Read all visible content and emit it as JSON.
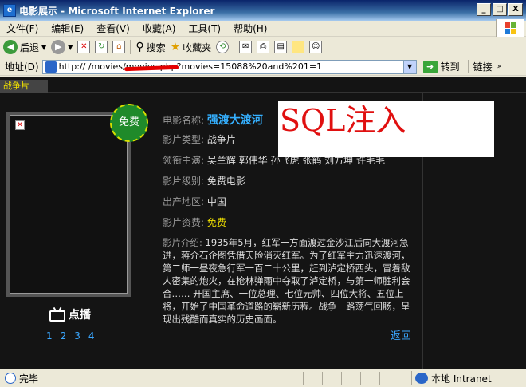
{
  "window": {
    "title": "电影展示 - Microsoft Internet Explorer",
    "buttons": {
      "minimize": "_",
      "maximize": "□",
      "close": "X"
    }
  },
  "menu": [
    "文件(F)",
    "编辑(E)",
    "查看(V)",
    "收藏(A)",
    "工具(T)",
    "帮助(H)"
  ],
  "toolbar": {
    "back": "后退",
    "search": "搜索",
    "favorites": "收藏夹"
  },
  "address": {
    "label": "地址(D)",
    "url": "http://                       /movies/movies.php?movies=15088%20and%201=1",
    "go": "转到",
    "links": "链接"
  },
  "page": {
    "category": "战争片",
    "badge": "免费",
    "play_label": "点播",
    "episodes": [
      "1",
      "2",
      "3",
      "4"
    ],
    "back_link": "返回",
    "overlay_text": "SQL注入",
    "movie": {
      "name_label": "电影名称:",
      "name": "强渡大渡河",
      "type_label": "影片类型:",
      "type": "战争片",
      "cast_label": "领衔主演:",
      "cast": "吴兰辉 郭伟华 孙飞虎 张鹤 刘方坤 许毛毛",
      "level_label": "影片级别:",
      "level": "免费电影",
      "region_label": "出产地区:",
      "region": "中国",
      "fee_label": "影片资费:",
      "fee": "免费",
      "synopsis_label": "影片介绍:",
      "synopsis": "1935年5月，红军一方面渡过金沙江后向大渡河急进，蒋介石企图凭借天险消灭红军。为了红军主力迅速渡河，第二师一昼夜急行军一百二十公里，赶到泸定桥西头，冒着敌人密集的炮火，在枪林弹雨中夺取了泸定桥，与第一师胜利会合……      开国主席、一位总理、七位元帅、四位大将、五位上将，开始了中国革命道路的崭新历程。战争一路荡气回肠，呈现出残酷而真实的历史画面。"
    }
  },
  "status": {
    "text": "完毕",
    "zone": "本地 Intranet"
  }
}
